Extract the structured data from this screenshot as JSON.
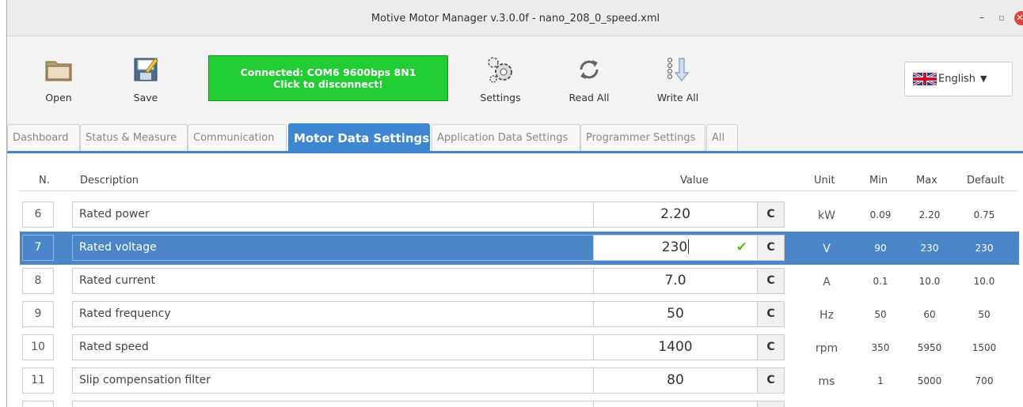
{
  "window": {
    "title": "Motive Motor Manager v.3.0.0f - nano_208_0_speed.xml",
    "min_glyph": "–",
    "max_glyph": "▫",
    "close_glyph": "✕"
  },
  "toolbar": {
    "open_label": "Open",
    "save_label": "Save",
    "connect_line1": "Connected: COM6 9600bps 8N1",
    "connect_line2": "Click to disconnect!",
    "settings_label": "Settings",
    "read_all_label": "Read All",
    "write_all_label": "Write All",
    "language": "English",
    "connect_color": "#22cc33"
  },
  "tabs": [
    {
      "label": "Dashboard",
      "active": false
    },
    {
      "label": "Status & Measure",
      "active": false
    },
    {
      "label": "Communication",
      "active": false
    },
    {
      "label": "Motor Data Settings",
      "active": true
    },
    {
      "label": "Application Data Settings",
      "active": false
    },
    {
      "label": "Programmer Settings",
      "active": false
    },
    {
      "label": "All",
      "active": false
    }
  ],
  "table": {
    "headers": {
      "n": "N.",
      "description": "Description",
      "value": "Value",
      "unit": "Unit",
      "min": "Min",
      "max": "Max",
      "default": "Default"
    },
    "reset_glyph": "C",
    "rows": [
      {
        "n": "6",
        "description": "Rated power",
        "value": "2.20",
        "unit": "kW",
        "min": "0.09",
        "max": "2.20",
        "default": "0.75",
        "selected": false
      },
      {
        "n": "7",
        "description": "Rated voltage",
        "value": "230",
        "unit": "V",
        "min": "90",
        "max": "230",
        "default": "230",
        "selected": true
      },
      {
        "n": "8",
        "description": "Rated current",
        "value": "7.0",
        "unit": "A",
        "min": "0.1",
        "max": "10.0",
        "default": "10.0",
        "selected": false
      },
      {
        "n": "9",
        "description": "Rated frequency",
        "value": "50",
        "unit": "Hz",
        "min": "50",
        "max": "60",
        "default": "50",
        "selected": false
      },
      {
        "n": "10",
        "description": "Rated speed",
        "value": "1400",
        "unit": "rpm",
        "min": "350",
        "max": "5950",
        "default": "1500",
        "selected": false
      },
      {
        "n": "11",
        "description": "Slip compensation filter",
        "value": "80",
        "unit": "ms",
        "min": "1",
        "max": "5000",
        "default": "700",
        "selected": false
      }
    ],
    "selected_color": "#4a86c8"
  }
}
